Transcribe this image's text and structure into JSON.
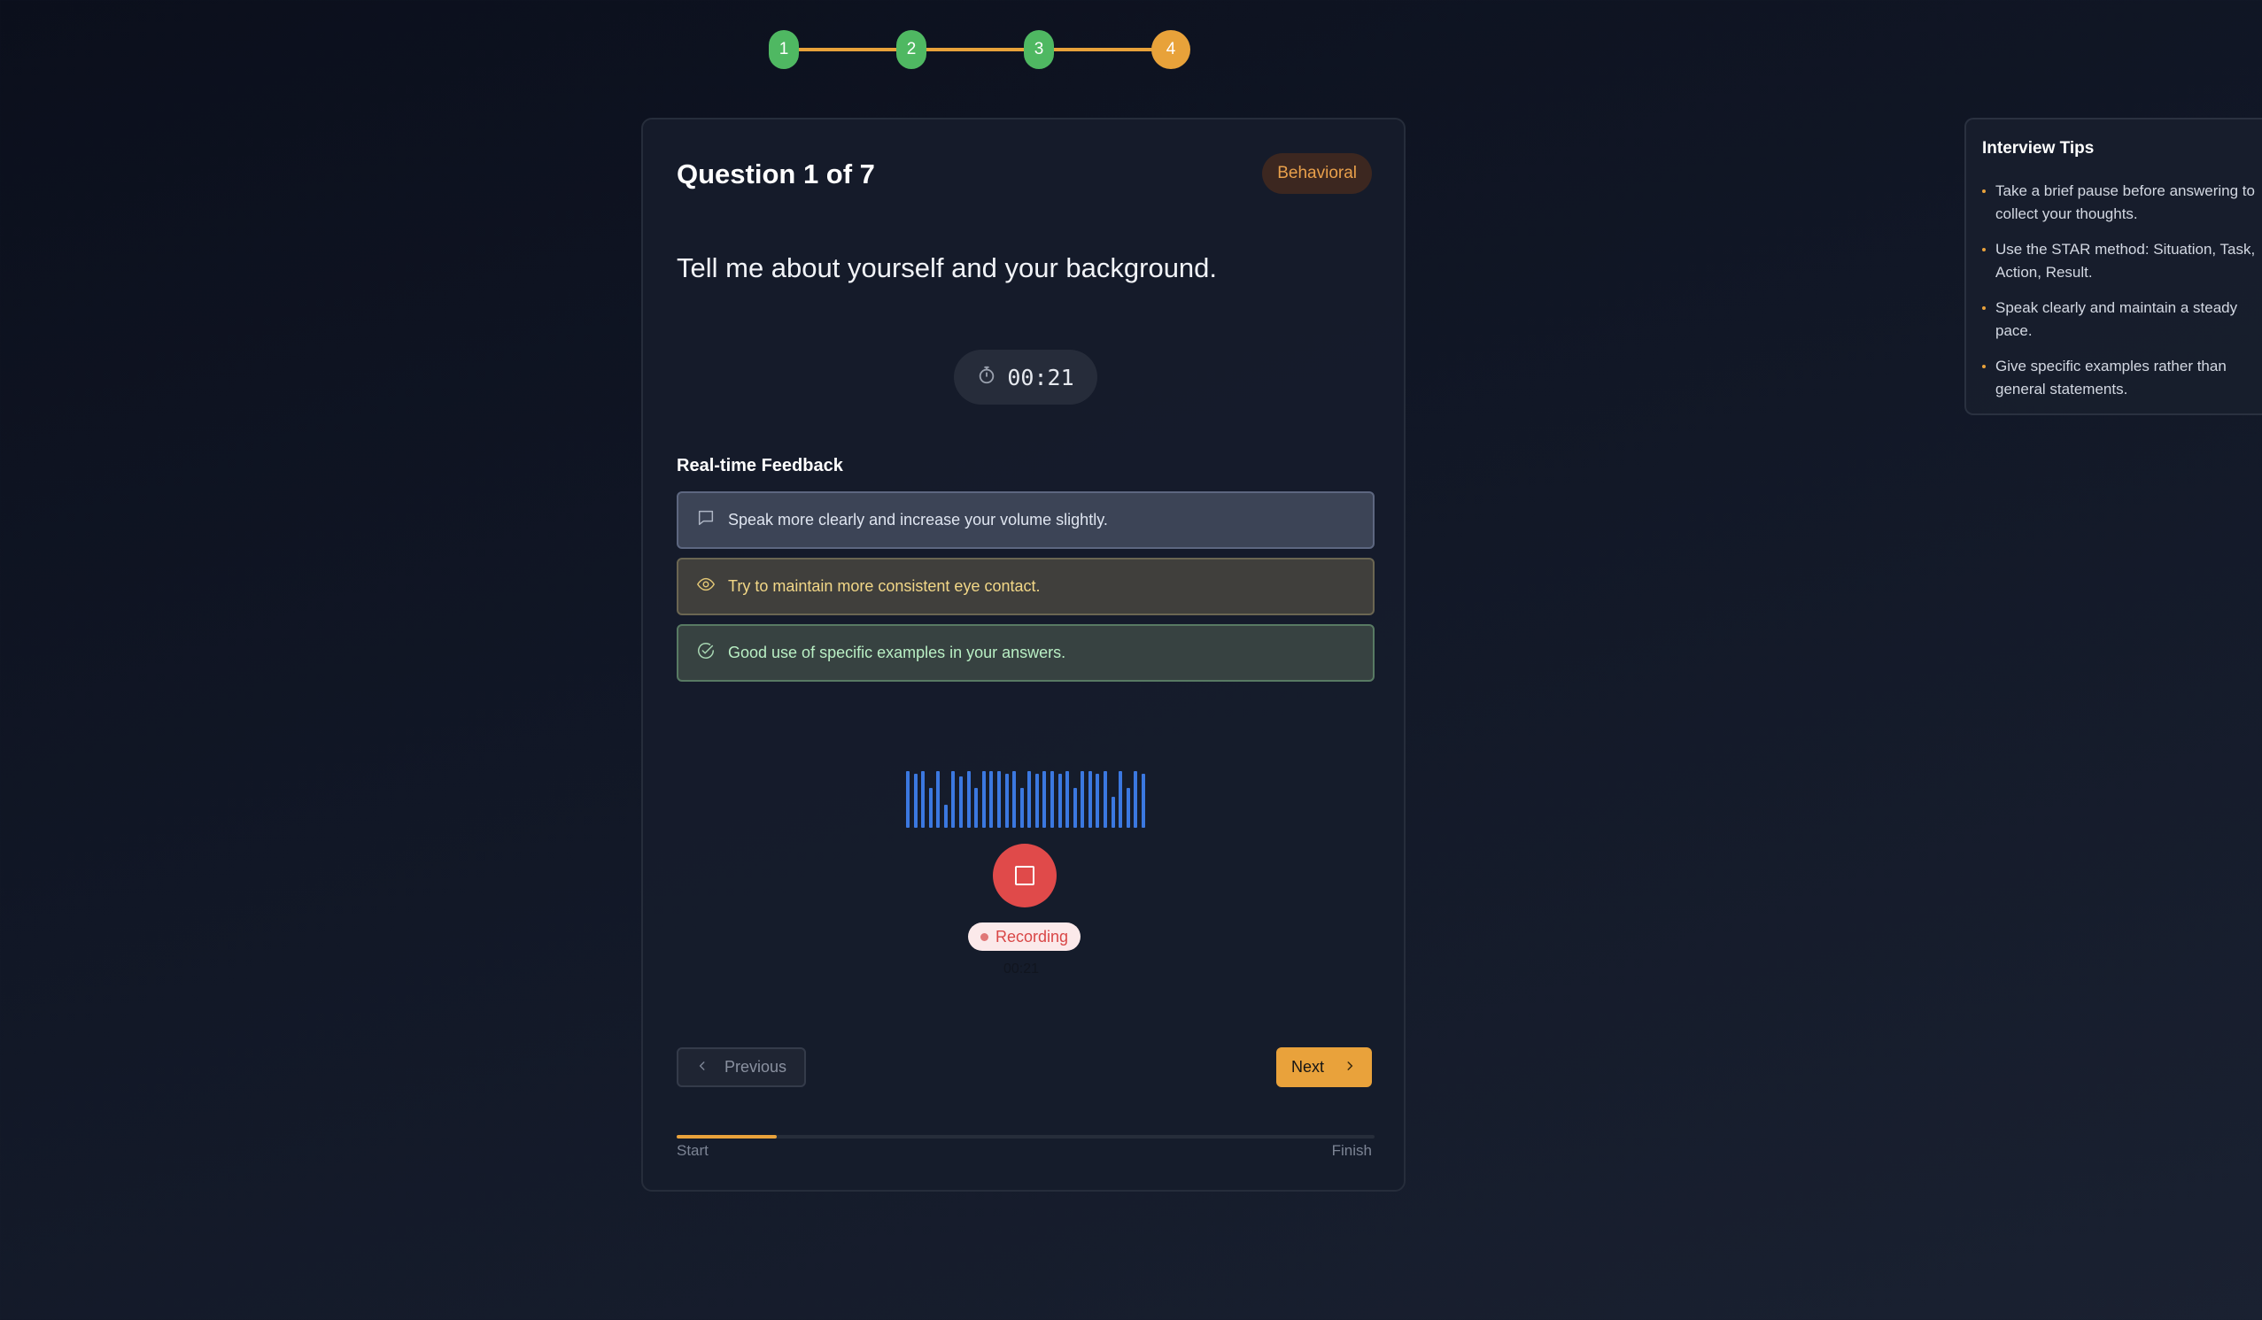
{
  "stepper": {
    "steps": [
      {
        "label": "1",
        "state": "done"
      },
      {
        "label": "2",
        "state": "done"
      },
      {
        "label": "3",
        "state": "done"
      },
      {
        "label": "4",
        "state": "active"
      }
    ]
  },
  "question": {
    "counter": "Question 1 of 7",
    "category": "Behavioral",
    "text": "Tell me about yourself and your background."
  },
  "timer": {
    "icon": "stopwatch-icon",
    "value": "00:21"
  },
  "feedback": {
    "title": "Real-time Feedback",
    "items": [
      {
        "icon": "chat-bubble-icon",
        "text": "Speak more clearly and increase your volume slightly.",
        "tone": "info"
      },
      {
        "icon": "eye-icon",
        "text": "Try to maintain more consistent eye contact.",
        "tone": "warning"
      },
      {
        "icon": "check-circle-icon",
        "text": "Good use of specific examples in your answers.",
        "tone": "positive"
      }
    ]
  },
  "recorder": {
    "status_label": "Recording",
    "elapsed": "00:21",
    "waveform_levels": [
      1,
      0.95,
      1,
      0.7,
      1,
      0.4,
      1,
      0.9,
      1,
      0.7,
      1,
      1,
      1,
      0.95,
      1,
      0.7,
      1,
      0.95,
      1,
      1,
      0.95,
      1,
      0.7,
      1,
      1,
      0.95,
      1,
      0.55,
      1,
      0.7,
      1,
      0.95
    ]
  },
  "navigation": {
    "previous_label": "Previous",
    "next_label": "Next"
  },
  "progress": {
    "start_label": "Start",
    "finish_label": "Finish",
    "fraction": 0.143
  },
  "tips": {
    "title": "Interview Tips",
    "items": [
      "Take a brief pause before answering to collect your thoughts.",
      "Use the STAR method: Situation, Task, Action, Result.",
      "Speak clearly and maintain a steady pace.",
      "Give specific examples rather than general statements."
    ]
  },
  "colors": {
    "accent": "#e9a23b",
    "success": "#4fb862",
    "recording": "#e04a4a",
    "waveform": "#3b78e0"
  }
}
